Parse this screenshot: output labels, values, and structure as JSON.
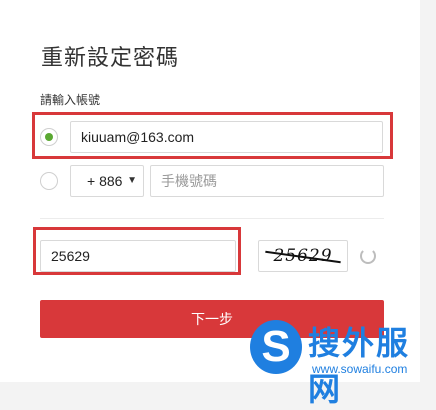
{
  "form": {
    "title": "重新設定密碼",
    "account_label": "請輸入帳號",
    "email_value": "kiuuam@163.com",
    "country_code": "+ 886",
    "phone_placeholder": "手機號碼",
    "captcha_value": "25629",
    "captcha_image_text": "25629",
    "submit_label": "下一步"
  },
  "watermark": {
    "logo_letter": "S",
    "text": "搜外服网",
    "url": "www.sowaifu.com"
  },
  "colors": {
    "accent_red": "#d8383a",
    "radio_green": "#5aa832",
    "watermark_blue": "#1f7fe0"
  },
  "icons": [
    "chevron-down-icon",
    "refresh-icon"
  ]
}
